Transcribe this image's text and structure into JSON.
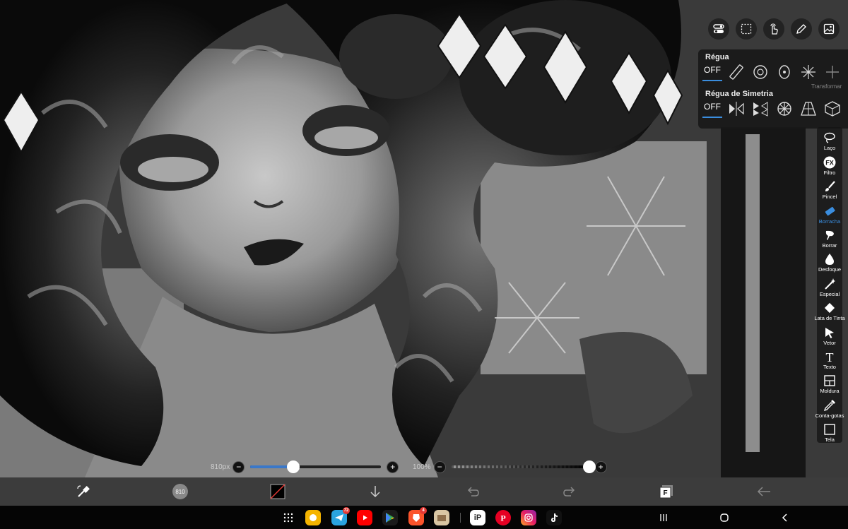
{
  "ruler_panel": {
    "title": "Régua",
    "off_label": "OFF",
    "transform_label": "Transformar",
    "symmetry_title": "Régua de Simetria",
    "symmetry_off_label": "OFF"
  },
  "side_tools": [
    {
      "label": "Laço",
      "icon": "lasso-icon"
    },
    {
      "label": "Filtro",
      "icon": "fx-icon"
    },
    {
      "label": "Pincel",
      "icon": "brush-icon"
    },
    {
      "label": "Borracha",
      "icon": "eraser-icon",
      "active": true
    },
    {
      "label": "Borrar",
      "icon": "smudge-icon"
    },
    {
      "label": "Desfoque",
      "icon": "blur-drop-icon"
    },
    {
      "label": "Especial",
      "icon": "magic-wand-icon"
    },
    {
      "label": "Lata de Tinta",
      "icon": "paint-bucket-icon"
    },
    {
      "label": "Vetor",
      "icon": "cursor-arrow-icon"
    },
    {
      "label": "Texto",
      "icon": "text-t-icon"
    },
    {
      "label": "Moldura",
      "icon": "frame-icon"
    },
    {
      "label": "Conta-gotas",
      "icon": "eyedropper-icon"
    },
    {
      "label": "Tela",
      "icon": "canvas-icon"
    }
  ],
  "brush_size": {
    "label": "810px",
    "fraction": 0.33
  },
  "opacity": {
    "label": "100%",
    "fraction": 1.0
  },
  "brush_badge": "810",
  "taskbar": {
    "telegram_badge": "72",
    "brave_badge": "4",
    "ibis_label": "iP"
  },
  "colors": {
    "accent": "#3a8dde",
    "bottom_bar": "#3c3c3c",
    "panel": "#191919"
  }
}
